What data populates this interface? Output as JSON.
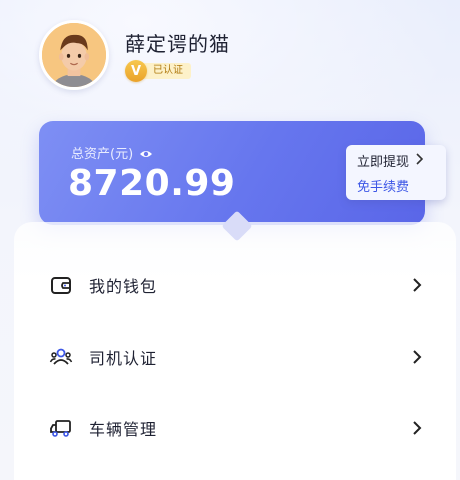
{
  "profile": {
    "username": "薛定谔的猫",
    "verified_badge": "V",
    "verified_text": "已认证"
  },
  "assets": {
    "label": "总资产(元)",
    "value": "8720.99",
    "withdraw_label": "立即提现",
    "withdraw_sub": "免手续费"
  },
  "menu": {
    "items": [
      {
        "label": "我的钱包",
        "icon": "wallet-icon"
      },
      {
        "label": "司机认证",
        "icon": "driver-users-icon"
      },
      {
        "label": "车辆管理",
        "icon": "truck-icon"
      }
    ]
  },
  "colors": {
    "card_gradient_start": "#7e8ff4",
    "card_gradient_end": "#5a66e8",
    "accent_blue": "#3d57e6",
    "badge_gold": "#eaa22a"
  }
}
